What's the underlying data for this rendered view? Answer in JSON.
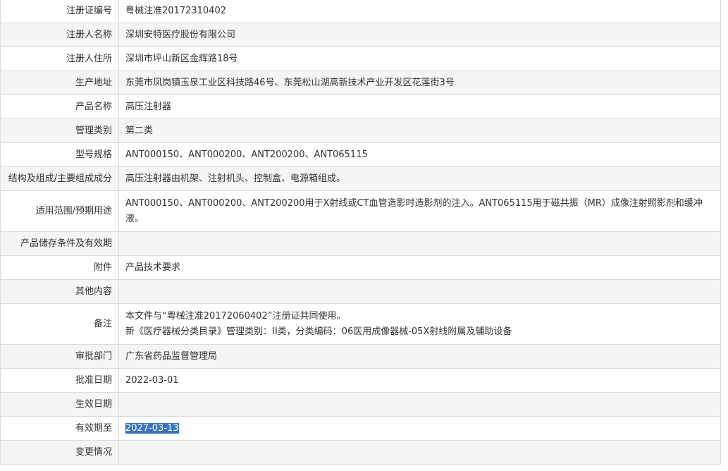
{
  "rows": [
    {
      "label": "注册证编号",
      "value": "粤械注准20172310402"
    },
    {
      "label": "注册人名称",
      "value": "深圳安特医疗股份有限公司"
    },
    {
      "label": "注册人住所",
      "value": "深圳市坪山新区金辉路18号"
    },
    {
      "label": "生产地址",
      "value": "东莞市凤岗镇玉泉工业区科技路46号、东莞松山湖高新技术产业开发区花莲街3号"
    },
    {
      "label": "产品名称",
      "value": "高压注射器"
    },
    {
      "label": "管理类别",
      "value": "第二类"
    },
    {
      "label": "型号规格",
      "value": "ANT000150、ANT000200、ANT200200、ANT065115"
    },
    {
      "label": "结构及组成/主要组成成分",
      "value": "高压注射器由机架、注射机头、控制盒、电源箱组成。"
    },
    {
      "label": "适用范围/预期用途",
      "value": "ANT000150、ANT000200、ANT200200用于X射线或CT血管造影时造影剂的注入。ANT065115用于磁共振（MR）成像注射照影剂和缓冲液。"
    },
    {
      "label": "产品储存条件及有效期",
      "value": ""
    },
    {
      "label": "附件",
      "value": "产品技术要求"
    },
    {
      "label": "其他内容",
      "value": ""
    },
    {
      "label": "备注",
      "line1": "本文件与“粤械注准20172060402”注册证共同使用。",
      "line2": "新《医疗器械分类目录》管理类别：II类，分类编码：06医用成像器械-05X射线附属及辅助设备"
    },
    {
      "label": "审批部门",
      "value": "广东省药品监督管理局"
    },
    {
      "label": "批准日期",
      "value": "2022-03-01"
    },
    {
      "label": "生效日期",
      "value": ""
    },
    {
      "label": "有效期至",
      "value": "2027-03-13"
    },
    {
      "label": "变更情况",
      "value": ""
    }
  ]
}
